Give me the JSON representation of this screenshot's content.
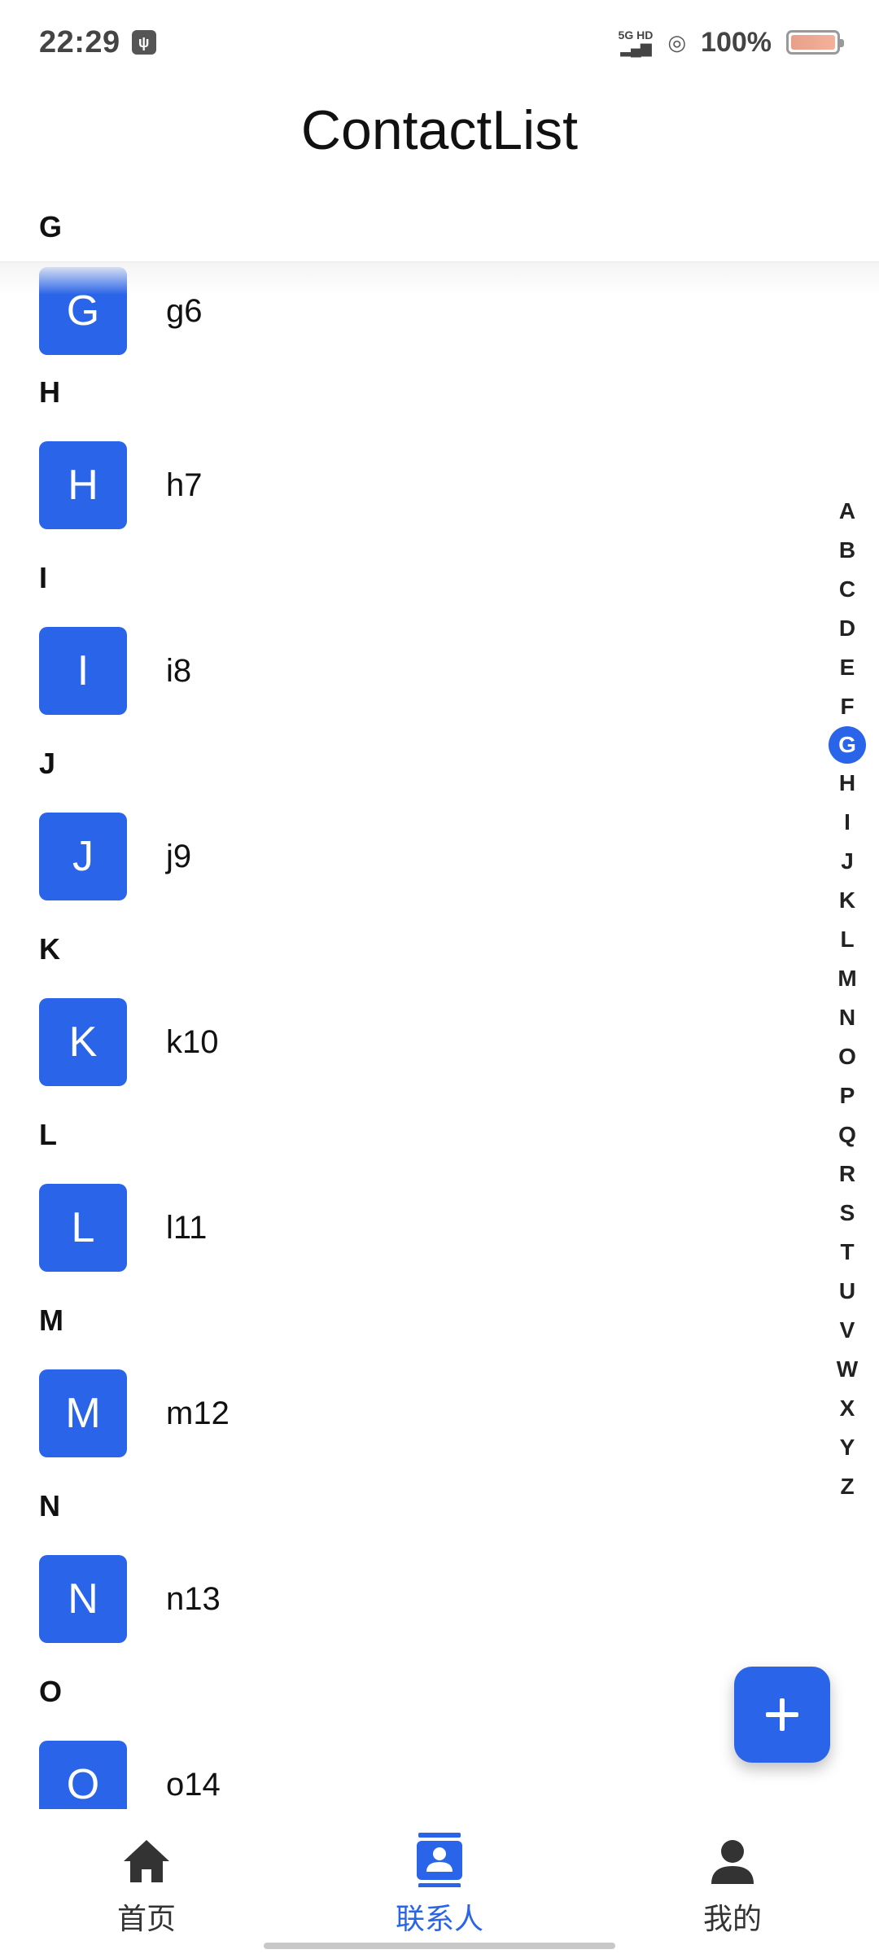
{
  "status_bar": {
    "time": "22:29",
    "network_label": "5G HD",
    "battery_percent": "100%"
  },
  "header": {
    "title": "ContactList"
  },
  "sticky_section": "G",
  "sections": [
    {
      "letter": "",
      "contacts": [
        {
          "initial": "G",
          "name": "g6"
        }
      ]
    },
    {
      "letter": "H",
      "contacts": [
        {
          "initial": "H",
          "name": "h7"
        }
      ]
    },
    {
      "letter": "I",
      "contacts": [
        {
          "initial": "I",
          "name": "i8"
        }
      ]
    },
    {
      "letter": "J",
      "contacts": [
        {
          "initial": "J",
          "name": "j9"
        }
      ]
    },
    {
      "letter": "K",
      "contacts": [
        {
          "initial": "K",
          "name": "k10"
        }
      ]
    },
    {
      "letter": "L",
      "contacts": [
        {
          "initial": "L",
          "name": "l11"
        }
      ]
    },
    {
      "letter": "M",
      "contacts": [
        {
          "initial": "M",
          "name": "m12"
        }
      ]
    },
    {
      "letter": "N",
      "contacts": [
        {
          "initial": "N",
          "name": "n13"
        }
      ]
    },
    {
      "letter": "O",
      "contacts": [
        {
          "initial": "O",
          "name": "o14"
        }
      ]
    }
  ],
  "index_letters": [
    "A",
    "B",
    "C",
    "D",
    "E",
    "F",
    "G",
    "H",
    "I",
    "J",
    "K",
    "L",
    "M",
    "N",
    "O",
    "P",
    "Q",
    "R",
    "S",
    "T",
    "U",
    "V",
    "W",
    "X",
    "Y",
    "Z"
  ],
  "index_active": "G",
  "fab": {
    "icon": "plus-icon"
  },
  "bottom_nav": [
    {
      "label": "首页",
      "icon": "home-icon",
      "active": false
    },
    {
      "label": "联系人",
      "icon": "contacts-icon",
      "active": true
    },
    {
      "label": "我的",
      "icon": "person-icon",
      "active": false
    }
  ],
  "colors": {
    "accent": "#2a64e8",
    "text": "#111111",
    "nav_inactive": "#333333"
  }
}
